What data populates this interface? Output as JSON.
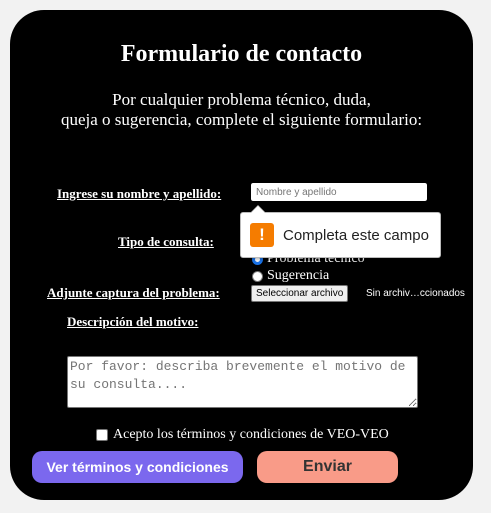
{
  "form": {
    "title": "Formulario de contacto",
    "subtitle_line1": "Por cualquier problema técnico, duda,",
    "subtitle_line2": "queja o sugerencia, complete el siguiente formulario:",
    "name_label": "Ingrese su nombre y apellido:",
    "name_placeholder": "Nombre y apellido",
    "name_value": "",
    "type_label": "Tipo de consulta:",
    "type_options": [
      {
        "label": "Problema técnico",
        "checked": true
      },
      {
        "label": "Sugerencia",
        "checked": false
      }
    ],
    "attach_label": "Adjunte captura del problema:",
    "file_button": "Seleccionar archivo",
    "file_status": "Sin archiv…ccionados",
    "description_label": "Descripción del motivo:",
    "description_placeholder": "Por favor: describa brevemente el motivo de su consulta....",
    "terms_label": "Acepto los términos y condiciones de VEO-VEO",
    "terms_checked": false,
    "terms_button": "Ver términos y condiciones",
    "submit_button": "Enviar"
  },
  "validation": {
    "message": "Completa este campo",
    "icon": "warning-icon",
    "icon_glyph": "!"
  },
  "colors": {
    "card_background": "#000000",
    "terms_button": "#7b68ee",
    "submit_button": "#f99b88",
    "warning": "#f57c00",
    "radio_checked": "#1a73e8"
  }
}
